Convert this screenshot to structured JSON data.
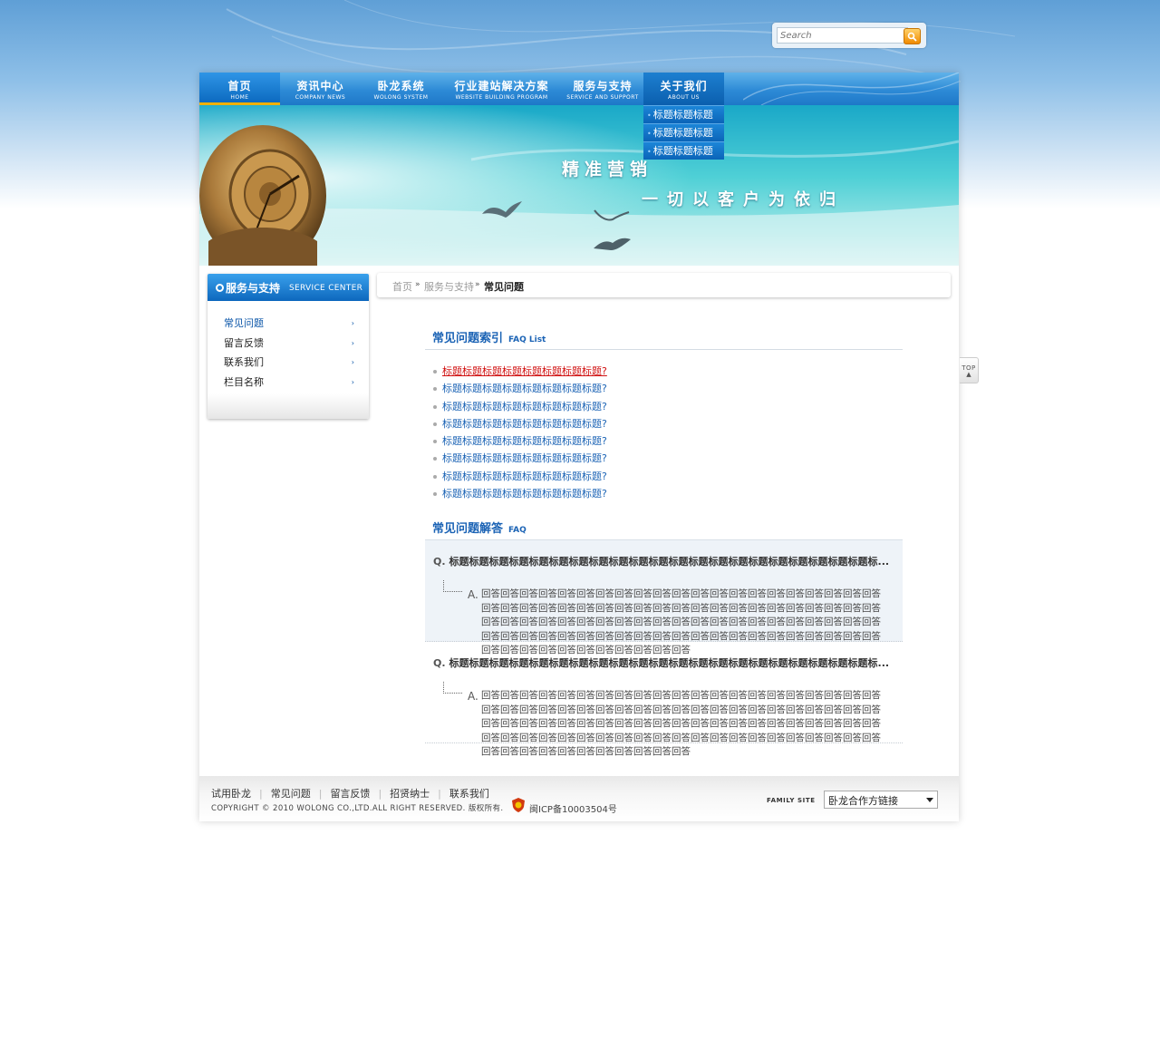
{
  "search": {
    "placeholder": "Search"
  },
  "nav": {
    "items": [
      {
        "cn": "首页",
        "en": "HOME"
      },
      {
        "cn": "资讯中心",
        "en": "COMPANY NEWS"
      },
      {
        "cn": "卧龙系统",
        "en": "WOLONG SYSTEM"
      },
      {
        "cn": "行业建站解决方案",
        "en": "WEBSITE BUILDING PROGRAM"
      },
      {
        "cn": "服务与支持",
        "en": "SERVICE AND SUPPORT"
      },
      {
        "cn": "关于我们",
        "en": "ABOUT US"
      }
    ],
    "dropdown": [
      "标题标题标题",
      "标题标题标题",
      "标题标题标题"
    ]
  },
  "banner": {
    "slogan1": "精准营销",
    "slogan2": "一切以客户为依归"
  },
  "sidebar": {
    "title": "服务与支持",
    "subtitle": "SERVICE CENTER",
    "items": [
      "常见问题",
      "留言反馈",
      "联系我们",
      "栏目名称"
    ]
  },
  "breadcrumb": {
    "home": "首页",
    "section": "服务与支持",
    "current": "常见问题",
    "separator": "»"
  },
  "faq_index": {
    "title": "常见问题索引",
    "title_en": "FAQ List",
    "links": [
      "标题标题标题标题标题标题标题标题?",
      "标题标题标题标题标题标题标题标题?",
      "标题标题标题标题标题标题标题标题?",
      "标题标题标题标题标题标题标题标题?",
      "标题标题标题标题标题标题标题标题?",
      "标题标题标题标题标题标题标题标题?",
      "标题标题标题标题标题标题标题标题?",
      "标题标题标题标题标题标题标题标题?"
    ]
  },
  "faq_answers": {
    "title": "常见问题解答",
    "title_en": "FAQ",
    "q_mark": "Q.",
    "a_mark": "A.",
    "items": [
      {
        "question": "标题标题标题标题标题标题标题标题标题标题标题标题标题标题标题标题标题标题标题标题标题标...",
        "answer": "回答回答回答回答回答回答回答回答回答回答回答回答回答回答回答回答回答回答回答回答回答回答回答回答回答回答回答回答回答回答回答回答回答回答回答回答回答回答回答回答回答回答回答回答回答回答回答回答回答回答回答回答回答回答回答回答回答回答回答回答回答回答回答回答回答回答回答回答回答回答回答回答回答回答回答回答回答回答回答回答回答回答回答回答回答回答回答回答回答回答回答回答回答回答回答"
      },
      {
        "question": "标题标题标题标题标题标题标题标题标题标题标题标题标题标题标题标题标题标题标题标题标题标...",
        "answer": "回答回答回答回答回答回答回答回答回答回答回答回答回答回答回答回答回答回答回答回答回答回答回答回答回答回答回答回答回答回答回答回答回答回答回答回答回答回答回答回答回答回答回答回答回答回答回答回答回答回答回答回答回答回答回答回答回答回答回答回答回答回答回答回答回答回答回答回答回答回答回答回答回答回答回答回答回答回答回答回答回答回答回答回答回答回答回答回答回答回答回答回答回答回答回答"
      }
    ]
  },
  "top_button": {
    "label": "TOP",
    "arrow": "▲"
  },
  "footer": {
    "links": [
      "试用卧龙",
      "常见问题",
      "留言反馈",
      "招贤纳士",
      "联系我们"
    ],
    "link_separator": "|",
    "copyright": "COPYRIGHT © 2010 WOLONG CO.,LTD.ALL RIGHT RESERVED. 版权所有.",
    "icp": "闽ICP备10003504号",
    "family_label": "FAMILY SITE",
    "family_select": "卧龙合作方链接"
  },
  "colors": {
    "nav_blue": "#2d8ad6",
    "link_blue": "#1b63b5",
    "hover_red": "#d01010",
    "banner_teal": "#3cc8d0",
    "accent_orange": "#f08a00"
  },
  "icons": [
    "search-icon",
    "bullet-icon",
    "chevron-right-icon",
    "police-badge-icon",
    "chevron-down-icon",
    "arrow-up-icon"
  ]
}
